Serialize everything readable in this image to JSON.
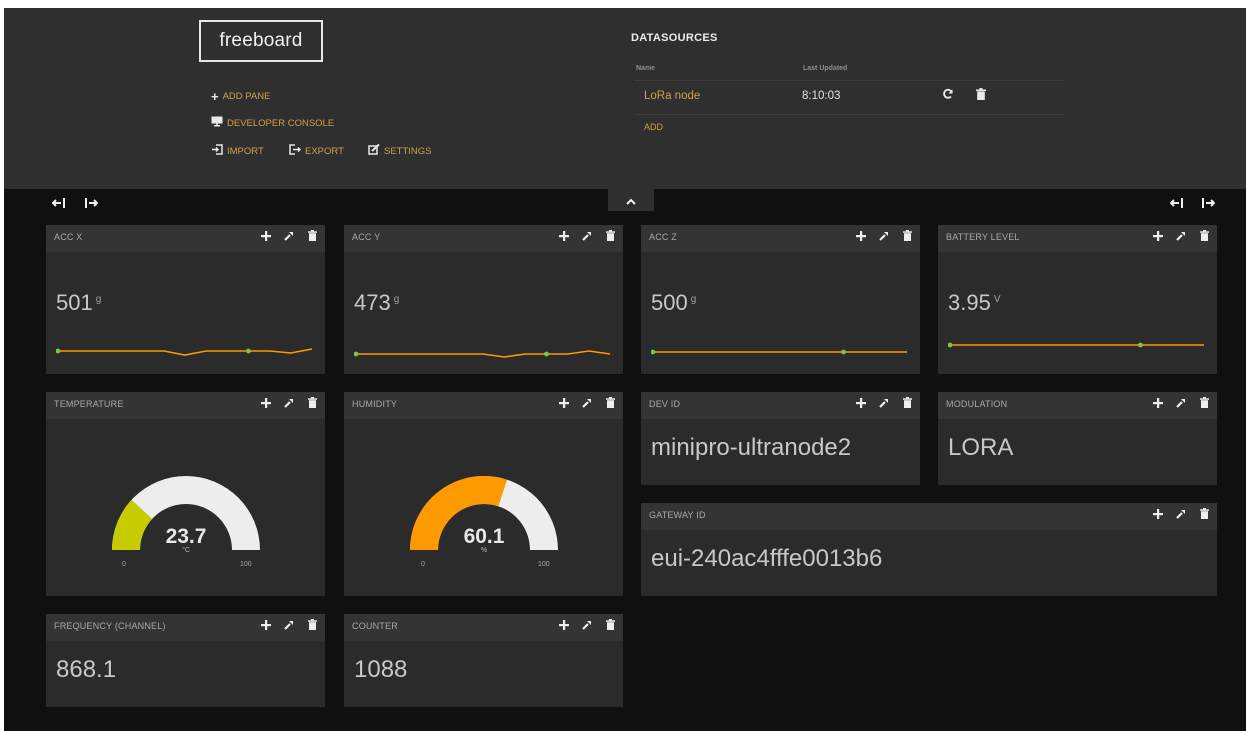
{
  "app": {
    "logo": "freeboard"
  },
  "menu": {
    "add_pane": "ADD PANE",
    "developer_console": "DEVELOPER CONSOLE",
    "import": "IMPORT",
    "export": "EXPORT",
    "settings": "SETTINGS"
  },
  "datasources": {
    "title": "DATASOURCES",
    "col_name": "Name",
    "col_updated": "Last Updated",
    "rows": [
      {
        "name": "LoRa node",
        "last_updated": "8:10:03"
      }
    ],
    "add_label": "ADD"
  },
  "panes": {
    "acc_x": {
      "title": "ACC X",
      "value": "501",
      "unit": "g",
      "spark": [
        501,
        501,
        501,
        501,
        501,
        501,
        500.8,
        501,
        501,
        501,
        501,
        500.9,
        501.1
      ]
    },
    "acc_y": {
      "title": "ACC Y",
      "value": "473",
      "unit": "g",
      "spark": [
        473,
        473,
        473,
        473,
        473,
        473,
        473,
        472.9,
        473,
        473,
        473,
        473.1,
        473
      ]
    },
    "acc_z": {
      "title": "ACC Z",
      "value": "500",
      "unit": "g",
      "spark": [
        500,
        500,
        500,
        500,
        500,
        500,
        500,
        500,
        500,
        500,
        500,
        500,
        500
      ]
    },
    "battery": {
      "title": "BATTERY LEVEL",
      "value": "3.95",
      "unit": "V",
      "spark": [
        3.95,
        3.95,
        3.95,
        3.95,
        3.95,
        3.95,
        3.95,
        3.95,
        3.95,
        3.95,
        3.95,
        3.95,
        3.95
      ]
    },
    "temperature": {
      "title": "TEMPERATURE",
      "value": "23.7",
      "unit": "°C",
      "min": "0",
      "max": "100",
      "fraction": 0.237,
      "color": "#c6cc00"
    },
    "humidity": {
      "title": "HUMIDITY",
      "value": "60.1",
      "unit": "%",
      "min": "0",
      "max": "100",
      "fraction": 0.601,
      "color": "#ff9900"
    },
    "dev_id": {
      "title": "DEV ID",
      "value": "minipro-ultranode2"
    },
    "modulation": {
      "title": "MODULATION",
      "value": "LORA"
    },
    "gateway_id": {
      "title": "GATEWAY ID",
      "value": "eui-240ac4fffe0013b6"
    },
    "frequency": {
      "title": "FREQUENCY (CHANNEL)",
      "value": "868.1"
    },
    "counter": {
      "title": "COUNTER",
      "value": "1088"
    }
  },
  "icons": {
    "plus": "plus-icon",
    "wrench": "wrench-icon",
    "trash": "trash-icon",
    "refresh": "refresh-icon",
    "chevron_up": "chevron-up-icon"
  },
  "colors": {
    "accent": "#d1a045",
    "sparkline": "#ff9900",
    "sparkline_dot": "#7cc445",
    "gauge_track": "#ededed"
  }
}
